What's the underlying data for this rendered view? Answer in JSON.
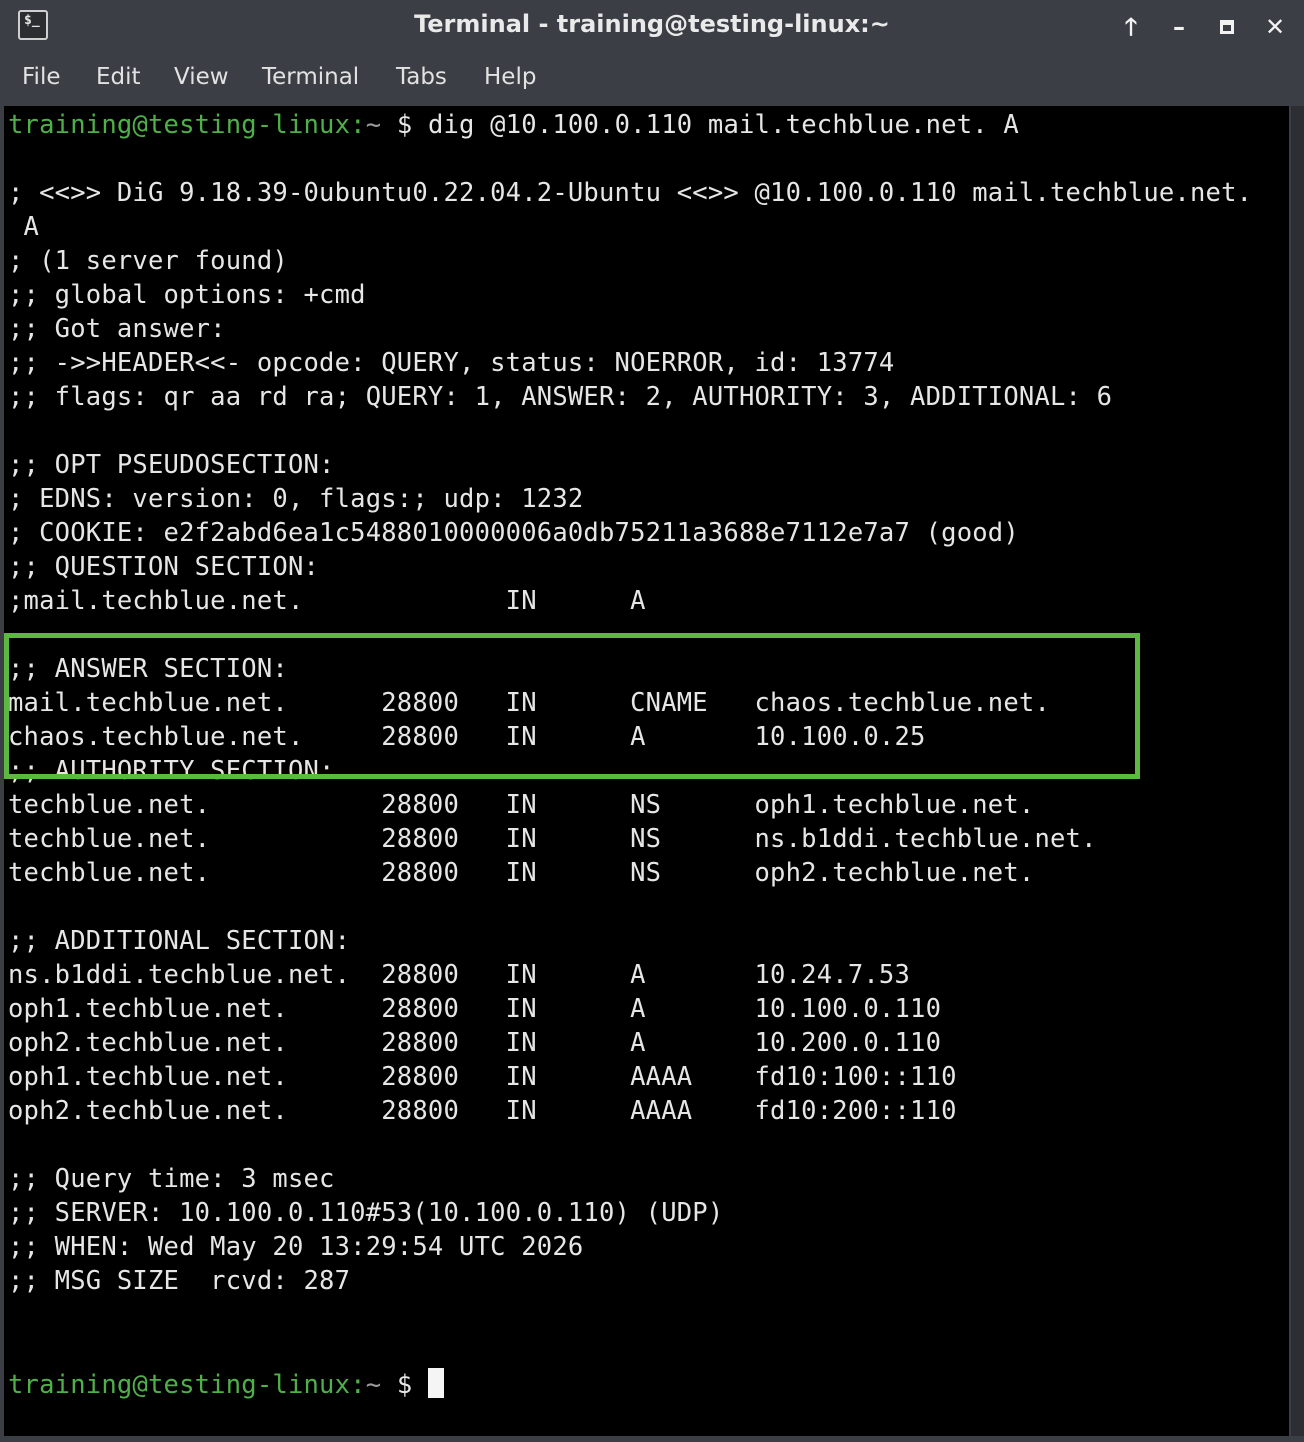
{
  "window": {
    "title": "Terminal - training@testing-linux:~",
    "icon_label": "$_",
    "controls": [
      "up-arrow-icon",
      "minimize-icon",
      "maximize-icon",
      "close-icon"
    ]
  },
  "menu": {
    "items": [
      "File",
      "Edit",
      "View",
      "Terminal",
      "Tabs",
      "Help"
    ]
  },
  "terminal": {
    "prompt_user": "training@testing-linux:",
    "prompt_path": "~",
    "prompt_symbol": "$",
    "command": "dig @10.100.0.110 mail.techblue.net. A",
    "lines": [
      "; <<>> DiG 9.18.39-0ubuntu0.22.04.2-Ubuntu <<>> @10.100.0.110 mail.techblue.net.",
      " A",
      "; (1 server found)",
      ";; global options: +cmd",
      ";; Got answer:",
      ";; ->>HEADER<<- opcode: QUERY, status: NOERROR, id: 13774",
      ";; flags: qr aa rd ra; QUERY: 1, ANSWER: 2, AUTHORITY: 3, ADDITIONAL: 6",
      "",
      ";; OPT PSEUDOSECTION:",
      "; EDNS: version: 0, flags:; udp: 1232",
      "; COOKIE: e2f2abd6ea1c5488010000006a0db75211a3688e7112e7a7 (good)",
      ";; QUESTION SECTION:",
      ";mail.techblue.net.             IN      A",
      "",
      ";; ANSWER SECTION:",
      "mail.techblue.net.      28800   IN      CNAME   chaos.techblue.net.",
      "chaos.techblue.net.     28800   IN      A       10.100.0.25",
      ";; AUTHORITY SECTION:",
      "techblue.net.           28800   IN      NS      oph1.techblue.net.",
      "techblue.net.           28800   IN      NS      ns.b1ddi.techblue.net.",
      "techblue.net.           28800   IN      NS      oph2.techblue.net.",
      "",
      ";; ADDITIONAL SECTION:",
      "ns.b1ddi.techblue.net.  28800   IN      A       10.24.7.53",
      "oph1.techblue.net.      28800   IN      A       10.100.0.110",
      "oph2.techblue.net.      28800   IN      A       10.200.0.110",
      "oph1.techblue.net.      28800   IN      AAAA    fd10:100::110",
      "oph2.techblue.net.      28800   IN      AAAA    fd10:200::110",
      "",
      ";; Query time: 3 msec",
      ";; SERVER: 10.100.0.110#53(10.100.0.110) (UDP)",
      ";; WHEN: Wed May 20 13:29:54 UTC 2026",
      ";; MSG SIZE  rcvd: 287",
      ""
    ]
  },
  "colors": {
    "prompt": "#4fb04a",
    "highlight_box": "#5cb840",
    "background": "#000000",
    "text": "#e6e6e6"
  }
}
